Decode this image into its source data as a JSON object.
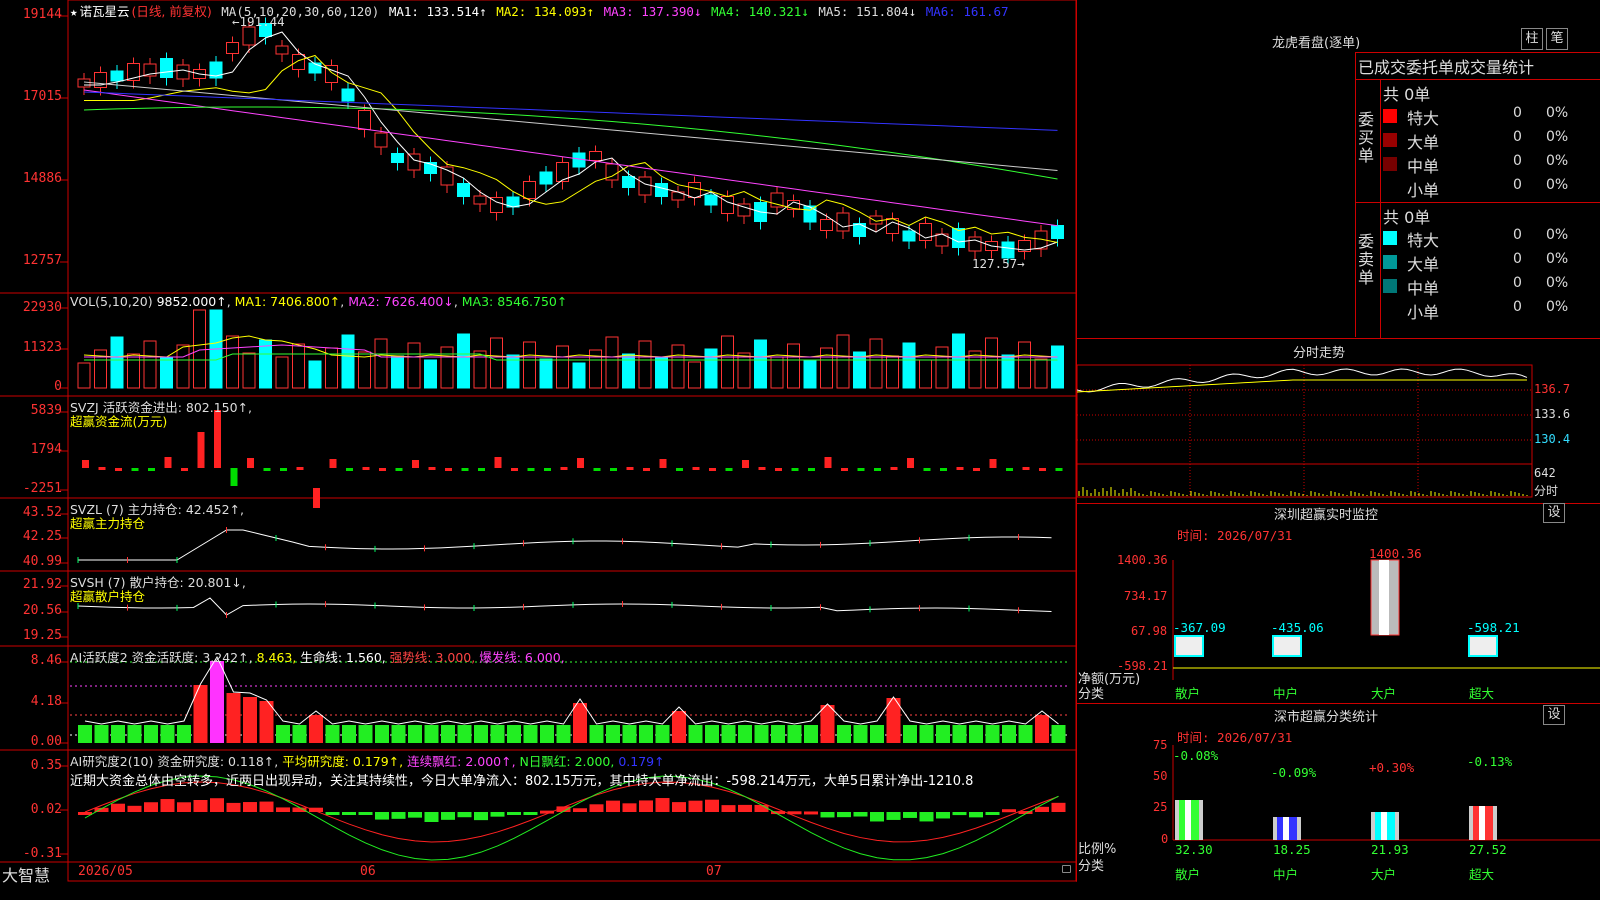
{
  "header": {
    "star": "★",
    "stock_name": "诺瓦星云",
    "period": "(日线, 前复权)",
    "ma_params": "MA(5,10,20,30,60,120)",
    "ma1": "MA1: 133.514↑",
    "ma2": "MA2: 134.093↑",
    "ma3": "MA3: 137.390↓",
    "ma4": "MA4: 140.321↓",
    "ma5": "MA5: 151.804↓",
    "ma6": "MA6: 161.67"
  },
  "price_axis": [
    "19144",
    "17015",
    "14886",
    "12757"
  ],
  "price_annotations": {
    "high": "←191.44",
    "low": "127.57→"
  },
  "vol_header": {
    "label": "VOL(5,10,20)",
    "value": "9852.000↑",
    "ma1": "MA1: 7406.800↑",
    "ma2": "MA2: 7626.400↓",
    "ma3": "MA3: 8546.750↑"
  },
  "vol_axis": [
    "22930",
    "11323",
    "0"
  ],
  "svzj": {
    "label": "SVZJ  活跃资金进出: 802.150↑,",
    "sub": "超赢资金流(万元)",
    "axis": [
      "5839",
      "1794",
      "-2251"
    ]
  },
  "svzl": {
    "label": "SVZL (7) 主力持仓: 42.452↑,",
    "sub": "超赢主力持仓",
    "axis": [
      "43.52",
      "42.25",
      "40.99"
    ]
  },
  "svsh": {
    "label": "SVSH (7) 散户持仓: 20.801↓,",
    "sub": "超赢散户持仓",
    "axis": [
      "21.92",
      "20.56",
      "19.25"
    ]
  },
  "ai_active": {
    "label": "AI活跃度2 资金活跃度: 3.242↑,",
    "v2": "8.463,",
    "life": "生命线: 1.560,",
    "strong": "强势线: 3.000,",
    "burst": "爆发线: 6.000,",
    "axis": [
      "8.46",
      "4.18",
      "0.00"
    ]
  },
  "ai_research": {
    "label": "AI研究度2(10) 资金研究度: 0.118↑,",
    "avg": "平均研究度: 0.179↑,",
    "red": "连续飘红: 2.000↑,",
    "nred": "N日飘红: 2.000,",
    "last": "0.179↑",
    "summary": "近期大资金总体由空转多，近两日出现异动，关注其持续性，今日大单净流入：802.15万元，其中特大单净流出：-598.214万元，大单5日累计净出-1210.8",
    "axis": [
      "0.35",
      "0.02",
      "-0.31"
    ]
  },
  "footer": {
    "brand": "大智慧",
    "d1": "2026/05",
    "d2": "06",
    "d3": "07"
  },
  "right": {
    "dragon_title": "龙虎看盘(逐单)",
    "btn_bar": "柱",
    "btn_pen": "笔",
    "tabs": "已成交委托单成交量统计",
    "buy_label": "委买单",
    "sell_label": "委卖单",
    "buy_total": "共 0单",
    "sell_total": "共 0单",
    "buy_rows": [
      {
        "name": "特大",
        "count": "0",
        "pct": "0%",
        "color": "#ff0000"
      },
      {
        "name": "大单",
        "count": "0",
        "pct": "0%",
        "color": "#990000"
      },
      {
        "name": "中单",
        "count": "0",
        "pct": "0%",
        "color": "#770000"
      },
      {
        "name": "小单",
        "count": "0",
        "pct": "0%",
        "color": "#000000"
      }
    ],
    "sell_rows": [
      {
        "name": "特大",
        "count": "0",
        "pct": "0%",
        "color": "#00ffff"
      },
      {
        "name": "大单",
        "count": "0",
        "pct": "0%",
        "color": "#009999"
      },
      {
        "name": "中单",
        "count": "0",
        "pct": "0%",
        "color": "#007777"
      },
      {
        "name": "小单",
        "count": "0",
        "pct": "0%",
        "color": "#000000"
      }
    ],
    "intraday_title": "分时走势",
    "intraday_axis": [
      "136.7",
      "133.6",
      "130.4",
      "642",
      "分时"
    ],
    "sz_monitor_title": "深圳超赢实时监控",
    "sz_time": "时间: 2026/07/31",
    "sz_axis": [
      "1400.36",
      "734.17",
      "67.98",
      "-598.21"
    ],
    "sz_values": [
      "-367.09",
      "-435.06",
      "1400.36",
      "-598.21"
    ],
    "sz_ylabel": "净额(万元)",
    "sz_xlabel": "分类",
    "categories": [
      "散户",
      "中户",
      "大户",
      "超大"
    ],
    "btn_set": "设",
    "stat_title": "深市超赢分类统计",
    "stat_time": "时间: 2026/07/31",
    "stat_axis": [
      "75",
      "50",
      "25",
      "0"
    ],
    "stat_top": [
      "-0.08%",
      "-0.09%",
      "+0.30%",
      "-0.13%"
    ],
    "stat_bottom": [
      "32.30",
      "18.25",
      "21.93",
      "27.52"
    ],
    "stat_ylabel": "比例%",
    "stat_xlabel": "分类"
  },
  "chart_data": {
    "type": "candlestick",
    "candles": [
      [
        1,
        1,
        0
      ],
      [
        1,
        0.5,
        1
      ],
      [
        0,
        1,
        1
      ],
      [
        1,
        0,
        0
      ],
      [
        1,
        1,
        0
      ],
      [
        0,
        1,
        1
      ],
      [
        1,
        0,
        0
      ],
      [
        1,
        0,
        1
      ],
      [
        0,
        1,
        0
      ],
      [
        1,
        1,
        1
      ],
      [
        1,
        0,
        1
      ],
      [
        0,
        1,
        1
      ],
      [
        1,
        1,
        0
      ],
      [
        1,
        0,
        1
      ],
      [
        0,
        1,
        1
      ],
      [
        1,
        0,
        0
      ],
      [
        0,
        1,
        1
      ],
      [
        1,
        0,
        0
      ],
      [
        1,
        1,
        0
      ],
      [
        0,
        1,
        1
      ],
      [
        1,
        1,
        0
      ],
      [
        0,
        0,
        1
      ],
      [
        1,
        1,
        0
      ],
      [
        0,
        1,
        1
      ],
      [
        1,
        0,
        1
      ],
      [
        1,
        1,
        0
      ],
      [
        0,
        1,
        1
      ],
      [
        1,
        1,
        0
      ],
      [
        0,
        0,
        1
      ],
      [
        1,
        1,
        1
      ],
      [
        0,
        1,
        0
      ],
      [
        1,
        0,
        1
      ],
      [
        1,
        1,
        0
      ],
      [
        0,
        1,
        1
      ],
      [
        1,
        1,
        0
      ],
      [
        0,
        1,
        0
      ],
      [
        1,
        0,
        1
      ],
      [
        1,
        1,
        0
      ],
      [
        0,
        1,
        1
      ],
      [
        1,
        0,
        0
      ],
      [
        1,
        1,
        0
      ],
      [
        0,
        1,
        1
      ],
      [
        1,
        0,
        0
      ],
      [
        1,
        0,
        1
      ],
      [
        0,
        1,
        0
      ],
      [
        1,
        1,
        1
      ],
      [
        1,
        0,
        1
      ],
      [
        0,
        1,
        1
      ],
      [
        1,
        1,
        0
      ],
      [
        1,
        0,
        0
      ],
      [
        0,
        1,
        1
      ],
      [
        1,
        0,
        1
      ],
      [
        1,
        1,
        0
      ],
      [
        0,
        1,
        1
      ],
      [
        1,
        0,
        0
      ],
      [
        1,
        1,
        0
      ],
      [
        0,
        1,
        1
      ],
      [
        1,
        0,
        0
      ],
      [
        1,
        1,
        1
      ],
      [
        0,
        1,
        0
      ]
    ]
  }
}
